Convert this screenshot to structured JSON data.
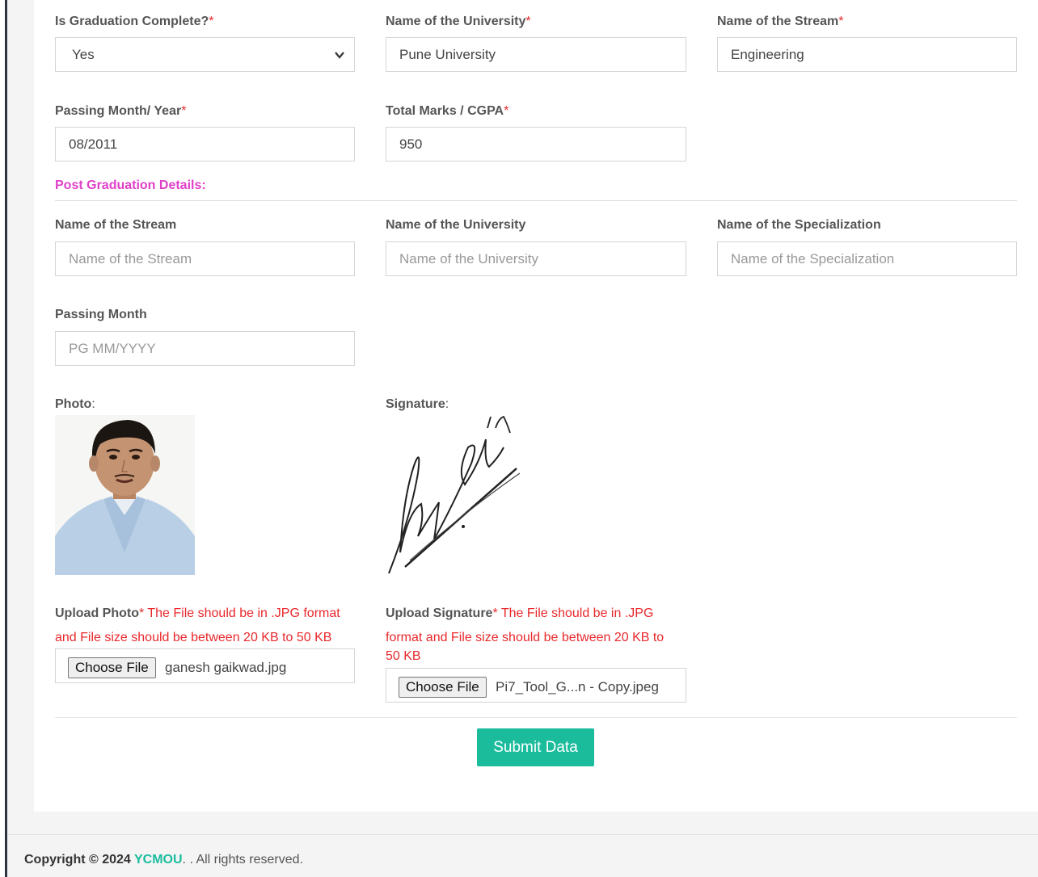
{
  "graduation": {
    "complete": {
      "label": "Is Graduation Complete?",
      "required": "*",
      "value": "Yes"
    },
    "university": {
      "label": "Name of the University",
      "required": "*",
      "value": "Pune University"
    },
    "stream": {
      "label": "Name of the Stream",
      "required": "*",
      "value": "Engineering"
    },
    "passing": {
      "label": "Passing Month/ Year",
      "required": "*",
      "value": "08/2011"
    },
    "marks": {
      "label": "Total Marks / CGPA",
      "required": "*",
      "value": "950"
    }
  },
  "post_graduation": {
    "section_title": "Post Graduation Details:",
    "stream": {
      "label": "Name of the Stream",
      "placeholder": "Name of the Stream"
    },
    "university": {
      "label": "Name of the University",
      "placeholder": "Name of the University"
    },
    "specialization": {
      "label": "Name of the Specialization",
      "placeholder": "Name of the Specialization"
    },
    "passing": {
      "label": "Passing Month",
      "placeholder": "PG MM/YYYY"
    }
  },
  "photo": {
    "label": "Photo",
    "colon": ":"
  },
  "signature": {
    "label": "Signature",
    "colon": ":"
  },
  "upload_photo": {
    "label": "Upload Photo",
    "required": "*",
    "note_line1": " The File should be in .JPG format",
    "note_line2": "and File size should be between 20 KB to 50 KB",
    "button": "Choose File",
    "filename": "ganesh gaikwad.jpg"
  },
  "upload_signature": {
    "label": "Upload Signature",
    "required": "*",
    "note_line1": " The File should be in .JPG",
    "note_line2": "format and File size should be between 20 KB to",
    "note_line3": "50 KB",
    "button": "Choose File",
    "filename": "Pi7_Tool_G...n - Copy.jpeg"
  },
  "submit_label": "Submit Data",
  "footer": {
    "prefix": "Copyright © 2024 ",
    "brand": "YCMOU",
    "suffix": ". . All rights reserved."
  },
  "colors": {
    "accent": "#1abc9c",
    "required": "#e8282c",
    "section_title": "#e040c8"
  },
  "icons": [
    "chevron-down-icon"
  ]
}
